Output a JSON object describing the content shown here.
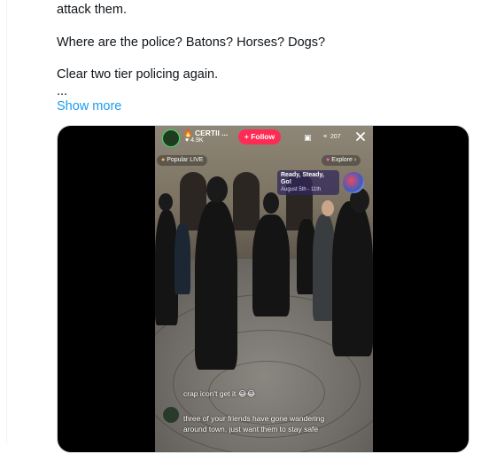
{
  "tweet": {
    "lines": [
      "attack them.",
      "Where are the police? Batons? Horses? Dogs?",
      "Clear two tier policing again.",
      "..."
    ],
    "show_more": "Show more"
  },
  "video": {
    "creator_name": "🔥 CERTII ...",
    "likes": "♥ 4.9K",
    "follow_label": "+ Follow",
    "viewer_count": "207",
    "popular_label": "Popular LIVE",
    "explore_label": "Explore",
    "event_title": "Ready, Steady, Go!",
    "event_date": "August 5th - 11th",
    "comments": [
      {
        "user": "",
        "text": "crap icon't get it 😂😂"
      },
      {
        "user": "",
        "text": "three of your friends have gone wandering"
      },
      {
        "user": "",
        "text": "around town, just want them to stay safe"
      }
    ]
  },
  "colors": {
    "link": "#1d9bf0",
    "follow_button": "#fe2c55",
    "text": "#0f1419"
  }
}
